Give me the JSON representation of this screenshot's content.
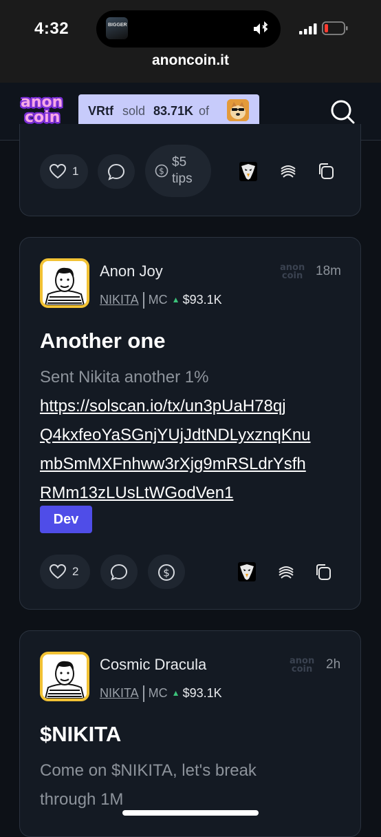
{
  "status_bar": {
    "time": "4:32",
    "island_thumb_text": "BIGGER",
    "url": "anoncoin.it"
  },
  "brand": {
    "logo_line1": "anon",
    "logo_line2": "coin",
    "accent": "#4f4de8"
  },
  "ticker": {
    "symbol": "VRtf",
    "verb": "sold",
    "amount": "83.71K",
    "of": "of"
  },
  "posts": [
    {
      "likes": "1",
      "tips": "$5 tips",
      "tips_line1": "$5",
      "tips_line2": "tips"
    },
    {
      "author": "Anon Joy",
      "watermark1": "anon",
      "watermark2": "coin",
      "time_ago": "18m",
      "token": "NIKITA",
      "mc_label": "MC",
      "mc_value": "$93.1K",
      "title": "Another one",
      "body": "Sent Nikita another 1%",
      "link_lines": [
        "https://solscan.io/tx/un3pUaH78qj",
        "Q4kxfeoYaSGnjYUjJdtNDLyxznqKnu",
        "mbSmMXFnhww3rXjg9mRSLdrYsfh",
        "RMm13zLUsLtWGodVen1"
      ],
      "badge": "Dev",
      "likes": "2"
    },
    {
      "author": "Cosmic Dracula",
      "watermark1": "anon",
      "watermark2": "coin",
      "time_ago": "2h",
      "token": "NIKITA",
      "mc_label": "MC",
      "mc_value": "$93.1K",
      "title": "$NIKITA",
      "body_lines": [
        "Come on $NIKITA, let's break",
        "through 1M"
      ]
    }
  ]
}
